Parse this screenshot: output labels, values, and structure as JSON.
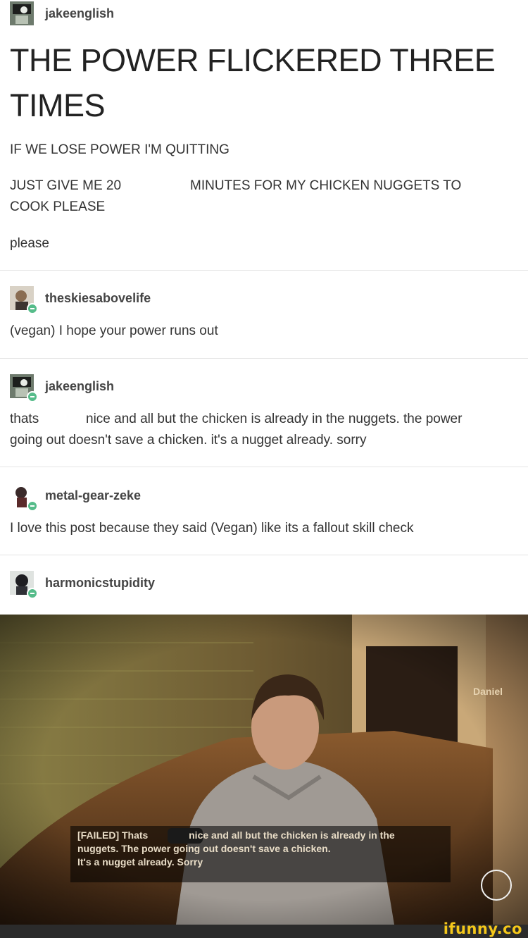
{
  "posts": [
    {
      "username": "jakeenglish"
    },
    {
      "username": "theskiesabovelife",
      "text": "(vegan) I hope your power runs out"
    },
    {
      "username": "jakeenglish",
      "line1a": "thats",
      "line1b": "nice and all but the chicken is already in the nuggets. the power",
      "line2": "going out doesn't save a chicken. it's a nugget already. sorry"
    },
    {
      "username": "metal-gear-zeke",
      "text": "I love this post because they said (Vegan) like its a fallout skill check"
    },
    {
      "username": "harmonicstupidity"
    }
  ],
  "original": {
    "title_line1": "THE POWER FLICKERED THREE",
    "title_line2": "TIMES",
    "line_quit": "IF WE LOSE POWER I'M QUITTING",
    "line_give_a": "JUST GIVE ME 20",
    "line_give_b": "MINUTES FOR MY CHICKEN NUGGETS TO",
    "line_cook": "COOK PLEASE",
    "line_please": "please"
  },
  "image": {
    "speaker": "Daniel",
    "caption_line1a": "[FAILED] Thats",
    "caption_line1b": "nice and all but the chicken is already in the",
    "caption_line2": "nuggets. The power going out doesn't save a chicken.",
    "caption_line3": "It's a nugget already. Sorry"
  },
  "watermark": "ifunny.co",
  "colors": {
    "badge": "#56bc8a",
    "watermark": "#f4c71a"
  }
}
